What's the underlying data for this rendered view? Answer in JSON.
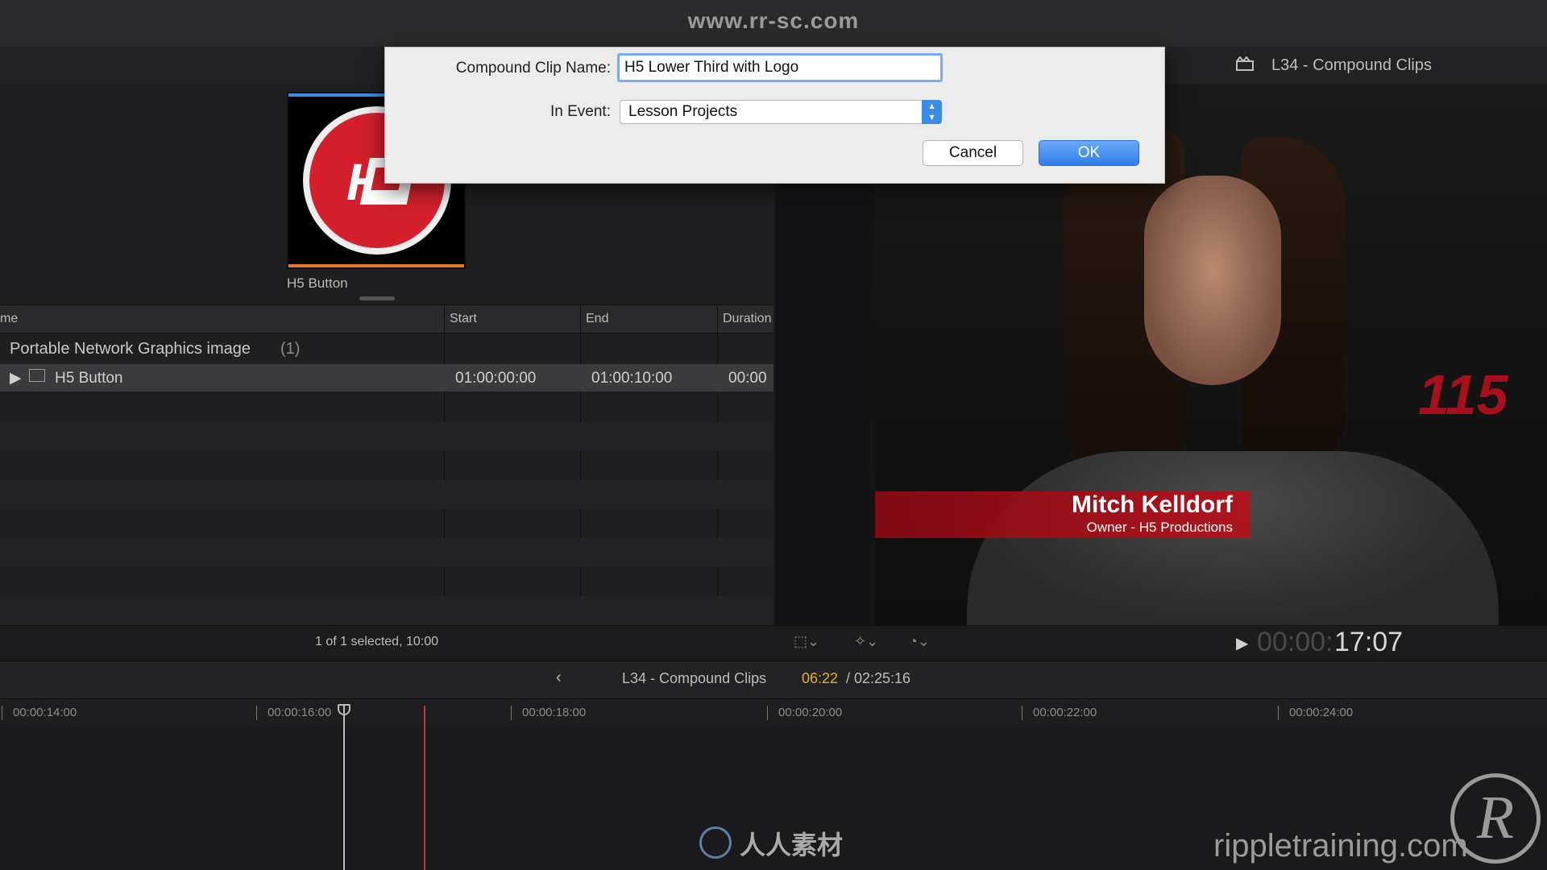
{
  "top_bar": {
    "url": "www.rr-sc.com"
  },
  "browser": {
    "thumbnail_label": "H5 Button",
    "columns": [
      "me",
      "Start",
      "End",
      "Duration"
    ],
    "group": {
      "title": "Portable Network Graphics image",
      "count": "(1)"
    },
    "rows": [
      {
        "name": "H5 Button",
        "start": "01:00:00:00",
        "end": "01:00:10:00",
        "duration": "00:00"
      }
    ],
    "status": "1 of 1 selected, 10:00"
  },
  "viewer": {
    "title": "L34 - Compound Clips",
    "lower_third": {
      "name": "Mitch Kelldorf",
      "subtitle": "Owner - H5 Productions"
    },
    "timecode_dim": "00:00:",
    "timecode": "17:07"
  },
  "timeline": {
    "title": "L34 - Compound Clips",
    "position": "06:22",
    "duration": "/ 02:25:16",
    "ruler": [
      "00:00:14:00",
      "00:00:16:00",
      "00:00:18:00",
      "00:00:20:00",
      "00:00:22:00",
      "00:00:24:00"
    ]
  },
  "dialog": {
    "name_label": "Compound Clip Name:",
    "name_value": "H5 Lower Third with Logo",
    "event_label": "In Event:",
    "event_value": "Lesson Projects",
    "cancel_label": "Cancel",
    "ok_label": "OK"
  },
  "watermark": {
    "cn": "人人素材",
    "site": "rippletraining.com",
    "r": "R"
  },
  "colors": {
    "accent": "#3a8ee6",
    "lower_third_red": "#b4121c",
    "timeline_pos": "#e3b21f",
    "skimmer": "#c0392b"
  }
}
